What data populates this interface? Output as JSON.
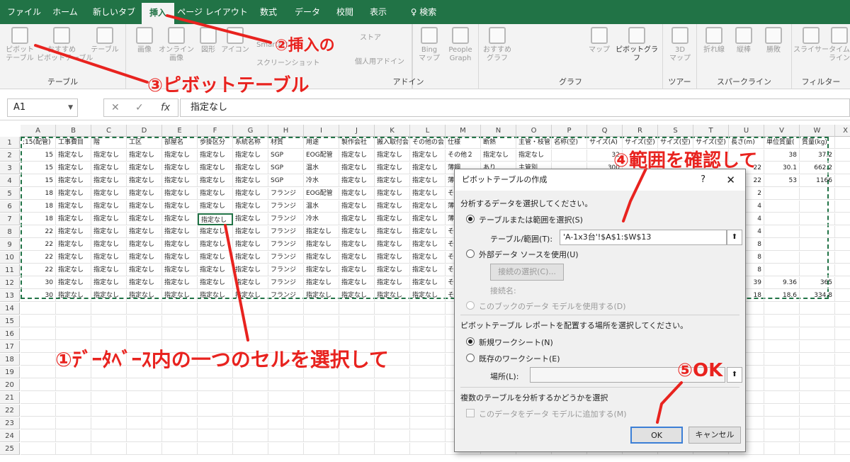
{
  "ribbon_tabs": [
    "ファイル",
    "ホーム",
    "新しいタブ",
    "挿入",
    "ページ レイアウト",
    "数式",
    "データ",
    "校閲",
    "表示"
  ],
  "search_label": "検索",
  "ribbon": {
    "table_group": {
      "label": "テーブル",
      "pivot": "ピボット\nテーブル",
      "recommended": "おすすめ\nピボットテーブル",
      "table": "テーブル"
    },
    "illust_group": {
      "image": "画像",
      "online": "オンライン\n画像",
      "shape": "図形",
      "icon": "アイコン",
      "smartart": "SmartArt",
      "screenshot": "スクリーンショット"
    },
    "addin_group": {
      "label": "アドイン",
      "store": "ストア",
      "personal": "個人用アドイン",
      "bing": "Bing\nマップ",
      "people": "People\nGraph"
    },
    "chart_group": {
      "label": "グラフ",
      "recommended": "おすすめ\nグラフ",
      "map": "マップ",
      "pivotchart": "ピボットグラフ"
    },
    "tour_group": {
      "label": "ツアー",
      "map3d": "3D\nマップ"
    },
    "spark_group": {
      "label": "スパークライン",
      "line": "折れ線",
      "column": "縦棒",
      "winloss": "勝敗"
    },
    "filter_group": {
      "label": "フィルター",
      "slicer": "スライサー",
      "timeline": "タイム\nライン"
    }
  },
  "name_box": "A1",
  "formula_value": "指定なし",
  "columns": [
    "A",
    "B",
    "C",
    "D",
    "E",
    "F",
    "G",
    "H",
    "I",
    "J",
    "K",
    "L",
    "M",
    "N",
    "O",
    "P",
    "Q",
    "R",
    "S",
    "T",
    "U",
    "V",
    "W",
    "X"
  ],
  "rows": [
    "1",
    "2",
    "3",
    "4",
    "5",
    "6",
    "7",
    "8",
    "9",
    "10",
    "11",
    "12",
    "13",
    "14",
    "15",
    "16",
    "17",
    "18",
    "19",
    "20",
    "21",
    "22",
    "23",
    "24",
    "25"
  ],
  "header_row": [
    ";15(配管)",
    "工事費目",
    "階",
    "工区",
    "部屋名",
    "歩掛区分",
    "系統名称",
    "材質",
    "用途",
    "製作会社",
    "搬入取付会",
    "その他の会",
    "仕様",
    "断熱",
    "主管・枝管",
    "名称(空)",
    "サイズ(A)",
    "サイズ(空)",
    "サイズ(空)",
    "サイズ(空)",
    "長さ(m)",
    "単位質量(",
    "質量(kg)",
    ""
  ],
  "data_rows": [
    [
      "15",
      "指定なし",
      "指定なし",
      "指定なし",
      "指定なし",
      "指定なし",
      "指定なし",
      "SGP",
      "EOG配管",
      "指定なし",
      "指定なし",
      "指定なし",
      "その他２",
      "指定なし",
      "指定なし",
      "",
      "32",
      "",
      "",
      "",
      "",
      "38",
      "37.2",
      ""
    ],
    [
      "15",
      "指定なし",
      "指定なし",
      "指定なし",
      "指定なし",
      "指定なし",
      "指定なし",
      "SGP",
      "温水",
      "指定なし",
      "指定なし",
      "指定なし",
      "薄鋼",
      "あり",
      "主管別",
      "",
      "300",
      "",
      "",
      "",
      "22",
      "30.1",
      "662.2",
      ""
    ],
    [
      "15",
      "指定なし",
      "指定なし",
      "指定なし",
      "指定なし",
      "指定なし",
      "指定なし",
      "SGP",
      "冷水",
      "指定なし",
      "指定なし",
      "指定なし",
      "薄鋼",
      "",
      "",
      "",
      "",
      "",
      "",
      "",
      "22",
      "53",
      "1166",
      ""
    ],
    [
      "18",
      "指定なし",
      "指定なし",
      "指定なし",
      "指定なし",
      "指定なし",
      "指定なし",
      "フランジ",
      "EOG配管",
      "指定なし",
      "指定なし",
      "指定なし",
      "その",
      "",
      "",
      "",
      "",
      "",
      "",
      "",
      "2",
      "",
      "",
      ""
    ],
    [
      "18",
      "指定なし",
      "指定なし",
      "指定なし",
      "指定なし",
      "指定なし",
      "指定なし",
      "フランジ",
      "温水",
      "指定なし",
      "指定なし",
      "指定なし",
      "薄鋼",
      "",
      "",
      "",
      "",
      "",
      "",
      "",
      "4",
      "",
      "",
      ""
    ],
    [
      "18",
      "指定なし",
      "指定なし",
      "指定なし",
      "指定なし",
      "指定なし",
      "指定なし",
      "フランジ",
      "冷水",
      "指定なし",
      "指定なし",
      "指定なし",
      "薄鋼",
      "",
      "",
      "",
      "",
      "",
      "",
      "",
      "4",
      "",
      "",
      ""
    ],
    [
      "22",
      "指定なし",
      "指定なし",
      "指定なし",
      "指定なし",
      "指定なし",
      "指定なし",
      "フランジ",
      "指定なし",
      "指定なし",
      "指定なし",
      "指定なし",
      "その",
      "",
      "",
      "",
      "",
      "",
      "",
      "",
      "4",
      "",
      "",
      ""
    ],
    [
      "22",
      "指定なし",
      "指定なし",
      "指定なし",
      "指定なし",
      "指定なし",
      "指定なし",
      "フランジ",
      "指定なし",
      "指定なし",
      "指定なし",
      "指定なし",
      "その",
      "",
      "",
      "",
      "",
      "",
      "",
      "",
      "8",
      "",
      "",
      ""
    ],
    [
      "22",
      "指定なし",
      "指定なし",
      "指定なし",
      "指定なし",
      "指定なし",
      "指定なし",
      "フランジ",
      "指定なし",
      "指定なし",
      "指定なし",
      "指定なし",
      "その",
      "",
      "",
      "",
      "",
      "",
      "",
      "",
      "8",
      "",
      "",
      ""
    ],
    [
      "22",
      "指定なし",
      "指定なし",
      "指定なし",
      "指定なし",
      "指定なし",
      "指定なし",
      "フランジ",
      "指定なし",
      "指定なし",
      "指定なし",
      "指定なし",
      "その",
      "",
      "",
      "",
      "",
      "",
      "",
      "",
      "8",
      "",
      "",
      ""
    ],
    [
      "30",
      "指定なし",
      "指定なし",
      "指定なし",
      "指定なし",
      "指定なし",
      "指定なし",
      "フランジ",
      "指定なし",
      "指定なし",
      "指定なし",
      "指定なし",
      "その",
      "",
      "",
      "",
      "",
      "",
      "",
      "",
      "39",
      "9.36",
      "365",
      ""
    ],
    [
      "30",
      "指定なし",
      "指定なし",
      "指定なし",
      "指定なし",
      "指定なし",
      "指定なし",
      "フランジ",
      "指定なし",
      "指定なし",
      "指定なし",
      "指定なし",
      "その",
      "",
      "",
      "",
      "",
      "",
      "",
      "",
      "18",
      "18.6",
      "334.8",
      ""
    ]
  ],
  "dialog": {
    "title": "ピボットテーブルの作成",
    "q": "?",
    "close": "✕",
    "section1": "分析するデータを選択してください。",
    "opt_table": "テーブルまたは範囲を選択(S)",
    "range_label": "テーブル/範囲(T):",
    "range_value": "'A-1x3台'!$A$1:$W$13",
    "opt_external": "外部データ ソースを使用(U)",
    "choose_conn": "接続の選択(C)...",
    "conn_name": "接続名:",
    "opt_model": "このブックのデータ モデルを使用する(D)",
    "section2": "ピボットテーブル レポートを配置する場所を選択してください。",
    "opt_new": "新規ワークシート(N)",
    "opt_existing": "既存のワークシート(E)",
    "location_label": "場所(L):",
    "section3": "複数のテーブルを分析するかどうかを選択",
    "add_model": "このデータをデータ モデルに追加する(M)",
    "ok": "OK",
    "cancel": "キャンセル"
  },
  "annotations": {
    "a1": "①ﾃﾞｰﾀﾍﾞｰｽ内の一つのセルを選択して",
    "a2": "②挿入の",
    "a3": "③ピボットテーブル",
    "a4": "④範囲を確認して",
    "a5": "⑤OK"
  },
  "colors": {
    "excel_green": "#217346",
    "annotation_red": "#e8231f"
  }
}
